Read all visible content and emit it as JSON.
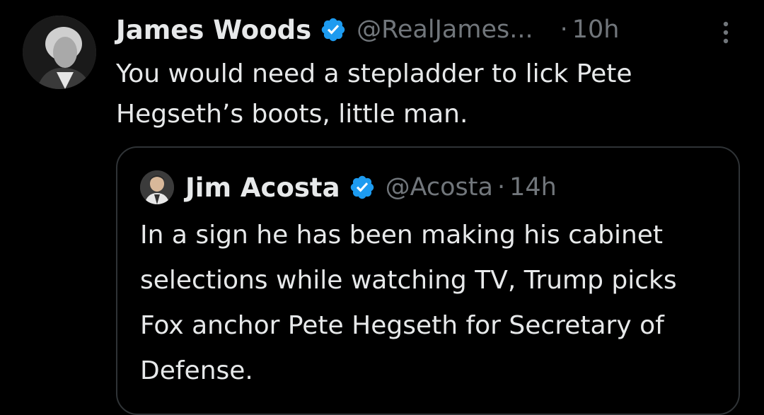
{
  "tweet": {
    "author_name": "James Woods",
    "author_handle": "@RealJames...",
    "separator": "·",
    "time": "10h",
    "text": "You would need a stepladder to lick Pete Hegseth’s boots, little man.",
    "icons": {
      "avatar": "profile-photo",
      "verified": "verified-badge-icon",
      "more": "more-options-icon"
    }
  },
  "quoted_tweet": {
    "author_name": "Jim Acosta",
    "author_handle": "@Acosta",
    "separator": "·",
    "time": "14h",
    "text": "In a sign he has been making his cabinet selections while watching TV, Trump picks Fox anchor Pete Hegseth for Secretary of Defense."
  },
  "colors": {
    "background": "#000000",
    "text_primary": "#e7e9ea",
    "text_secondary": "#71767b",
    "verified_blue": "#1d9bf0",
    "border": "#2f3336"
  }
}
